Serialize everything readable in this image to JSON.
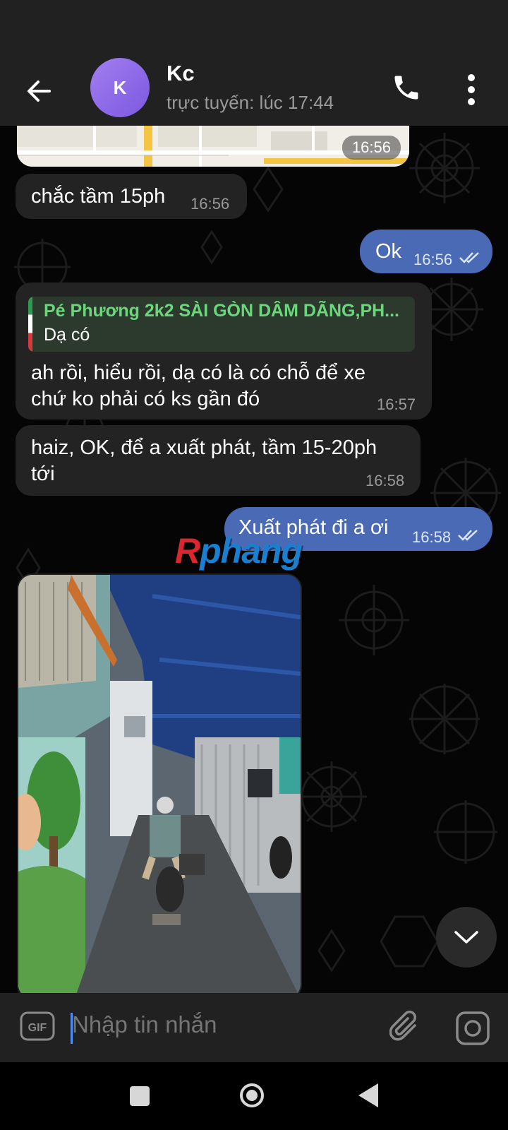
{
  "header": {
    "avatar_letter": "K",
    "contact_name": "Kc",
    "status": "trực tuyến: lúc 17:44"
  },
  "messages": [
    {
      "type": "map",
      "direction": "in",
      "time": "16:56"
    },
    {
      "type": "text",
      "direction": "in",
      "text": "chắc tầm 15ph",
      "time": "16:56"
    },
    {
      "type": "text",
      "direction": "out",
      "text": "Ok",
      "time": "16:56",
      "read": true
    },
    {
      "type": "reply",
      "direction": "in",
      "reply_to": {
        "name": "Pé Phương 2k2 SÀI GÒN DÂM DÃNG,PH...",
        "text": "Dạ có"
      },
      "lines": [
        "ah rồi, hiểu rồi, dạ có là có chỗ để xe",
        "chứ ko phải có ks gần đó"
      ],
      "time": "16:57"
    },
    {
      "type": "text",
      "direction": "in",
      "lines": [
        "haiz, OK, để a xuất phát, tầm 15-20ph",
        "tới"
      ],
      "time": "16:58"
    },
    {
      "type": "text",
      "direction": "out",
      "text": "Xuất phát đi a ơi",
      "time": "16:58",
      "read": true
    },
    {
      "type": "photo",
      "direction": "in"
    }
  ],
  "watermark": {
    "first": "R",
    "rest": "phang"
  },
  "input": {
    "placeholder": "Nhập tin nhắn"
  },
  "icons": [
    "back-arrow-icon",
    "phone-icon",
    "more-vertical-icon",
    "double-check-icon",
    "chevron-down-icon",
    "gif-icon",
    "paperclip-icon",
    "camera-icon"
  ],
  "colors": {
    "outgoing_bubble": "#4b6ab5",
    "incoming_bubble": "#232323",
    "reply_name": "#6ad77c",
    "avatar": "#8e6be8"
  }
}
